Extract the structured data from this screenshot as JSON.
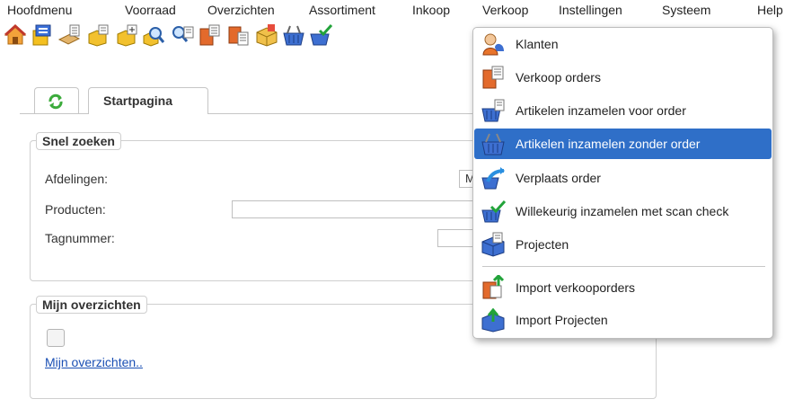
{
  "menubar": {
    "items": [
      "Hoofdmenu",
      "Voorraad",
      "Overzichten",
      "Assortiment",
      "Inkoop",
      "Verkoop",
      "Instellingen",
      "Systeem",
      "Help"
    ]
  },
  "toolbar": {
    "icons": [
      "home-icon",
      "warehouse-icon",
      "pallet-icon",
      "product-icon",
      "product-add-icon",
      "search-icon",
      "search-doc-icon",
      "order-icon",
      "order-edit-icon",
      "box-icon",
      "basket-icon",
      "basket-check-icon"
    ]
  },
  "tabs": {
    "refresh_icon": "refresh-icon",
    "start_label": "Startpagina"
  },
  "quick_search": {
    "legend": "Snel zoeken",
    "departments_label": "Afdelingen:",
    "departments_value": "M",
    "products_label": "Producten:",
    "tag_label": "Tagnummer:"
  },
  "overviews": {
    "legend": "Mijn overzichten",
    "link": "Mijn overzichten.."
  },
  "dropdown": {
    "items": [
      {
        "label": "Klanten",
        "icon": "customers-icon"
      },
      {
        "label": "Verkoop orders",
        "icon": "sales-order-icon"
      },
      {
        "label": "Artikelen inzamelen voor order",
        "icon": "basket-order-icon"
      },
      {
        "label": "Artikelen inzamelen zonder order",
        "icon": "basket-icon"
      },
      {
        "label": "Verplaats order",
        "icon": "move-order-icon"
      },
      {
        "label": "Willekeurig inzamelen met scan check",
        "icon": "basket-check-icon"
      },
      {
        "label": "Projecten",
        "icon": "projects-icon"
      },
      {
        "label": "Import verkooporders",
        "icon": "import-orders-icon"
      },
      {
        "label": "Import Projecten",
        "icon": "import-projects-icon"
      }
    ],
    "active_index": 3,
    "highlight_color": "#2f6fc8"
  }
}
